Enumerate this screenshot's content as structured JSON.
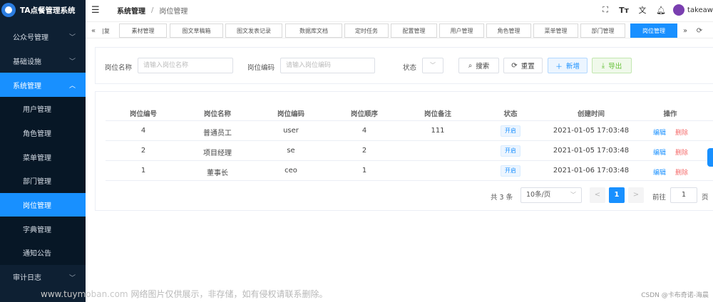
{
  "app": {
    "title": "TA点餐管理系统"
  },
  "sidebar": {
    "items": [
      {
        "label": "公众号管理"
      },
      {
        "label": "基础设施"
      },
      {
        "label": "系统管理"
      },
      {
        "label": "审计日志"
      }
    ],
    "sub_items": [
      {
        "label": "用户管理"
      },
      {
        "label": "角色管理"
      },
      {
        "label": "菜单管理"
      },
      {
        "label": "部门管理"
      },
      {
        "label": "岗位管理"
      },
      {
        "label": "字典管理"
      },
      {
        "label": "通知公告"
      }
    ]
  },
  "header": {
    "breadcrumb": [
      "系统管理",
      "/",
      "岗位管理"
    ],
    "icons": [
      "fullscreen-icon",
      "font-size-icon",
      "translate-icon",
      "bell-icon"
    ],
    "user": "takeaw"
  },
  "tabs": {
    "prev": "«",
    "next": "»",
    "refresh": "⟳",
    "items": [
      {
        "label": "|复"
      },
      {
        "label": "素材管理"
      },
      {
        "label": "图文草稿箱"
      },
      {
        "label": "图文发表记录"
      },
      {
        "label": "数据库文档"
      },
      {
        "label": "定时任务"
      },
      {
        "label": "配置管理"
      },
      {
        "label": "用户管理"
      },
      {
        "label": "角色管理"
      },
      {
        "label": "菜单管理"
      },
      {
        "label": "部门管理"
      },
      {
        "label": "岗位管理"
      }
    ]
  },
  "search": {
    "name_label": "岗位名称",
    "name_placeholder": "请输入岗位名称",
    "code_label": "岗位编码",
    "code_placeholder": "请输入岗位编码",
    "status_label": "状态",
    "status_chevron": "﹀",
    "search_btn": "搜索",
    "reset_btn": "重置",
    "add_btn": "新增",
    "export_btn": "导出"
  },
  "table": {
    "columns": [
      "岗位编号",
      "岗位名称",
      "岗位编码",
      "岗位顺序",
      "岗位备注",
      "状态",
      "创建时间",
      "操作"
    ],
    "rows": [
      {
        "id": "4",
        "name": "普通员工",
        "code": "user",
        "order": "4",
        "remark": "111",
        "status": "开启",
        "created": "2021-01-05 17:03:48",
        "edit": "编辑",
        "delete": "删除"
      },
      {
        "id": "2",
        "name": "项目经理",
        "code": "se",
        "order": "2",
        "remark": "",
        "status": "开启",
        "created": "2021-01-05 17:03:48",
        "edit": "编辑",
        "delete": "删除"
      },
      {
        "id": "1",
        "name": "董事长",
        "code": "ceo",
        "order": "1",
        "remark": "",
        "status": "开启",
        "created": "2021-01-06 17:03:48",
        "edit": "编辑",
        "delete": "删除"
      }
    ]
  },
  "pagination": {
    "total": "共 3 条",
    "page_size": "10条/页",
    "prev": "<",
    "current": "1",
    "next": ">",
    "goto": "前往",
    "goto_value": "1",
    "unit": "页"
  },
  "watermark": {
    "site": "www.tuymoban.com",
    "text": "网络图片仅供展示，非存储，如有侵权请联系删除。",
    "credit": "CSDN @卡布奇诺-海晨"
  },
  "colors": {
    "accent": "#1890ff",
    "sidebar": "#0e2033",
    "danger": "#f56c6c",
    "success": "#67c23a"
  }
}
